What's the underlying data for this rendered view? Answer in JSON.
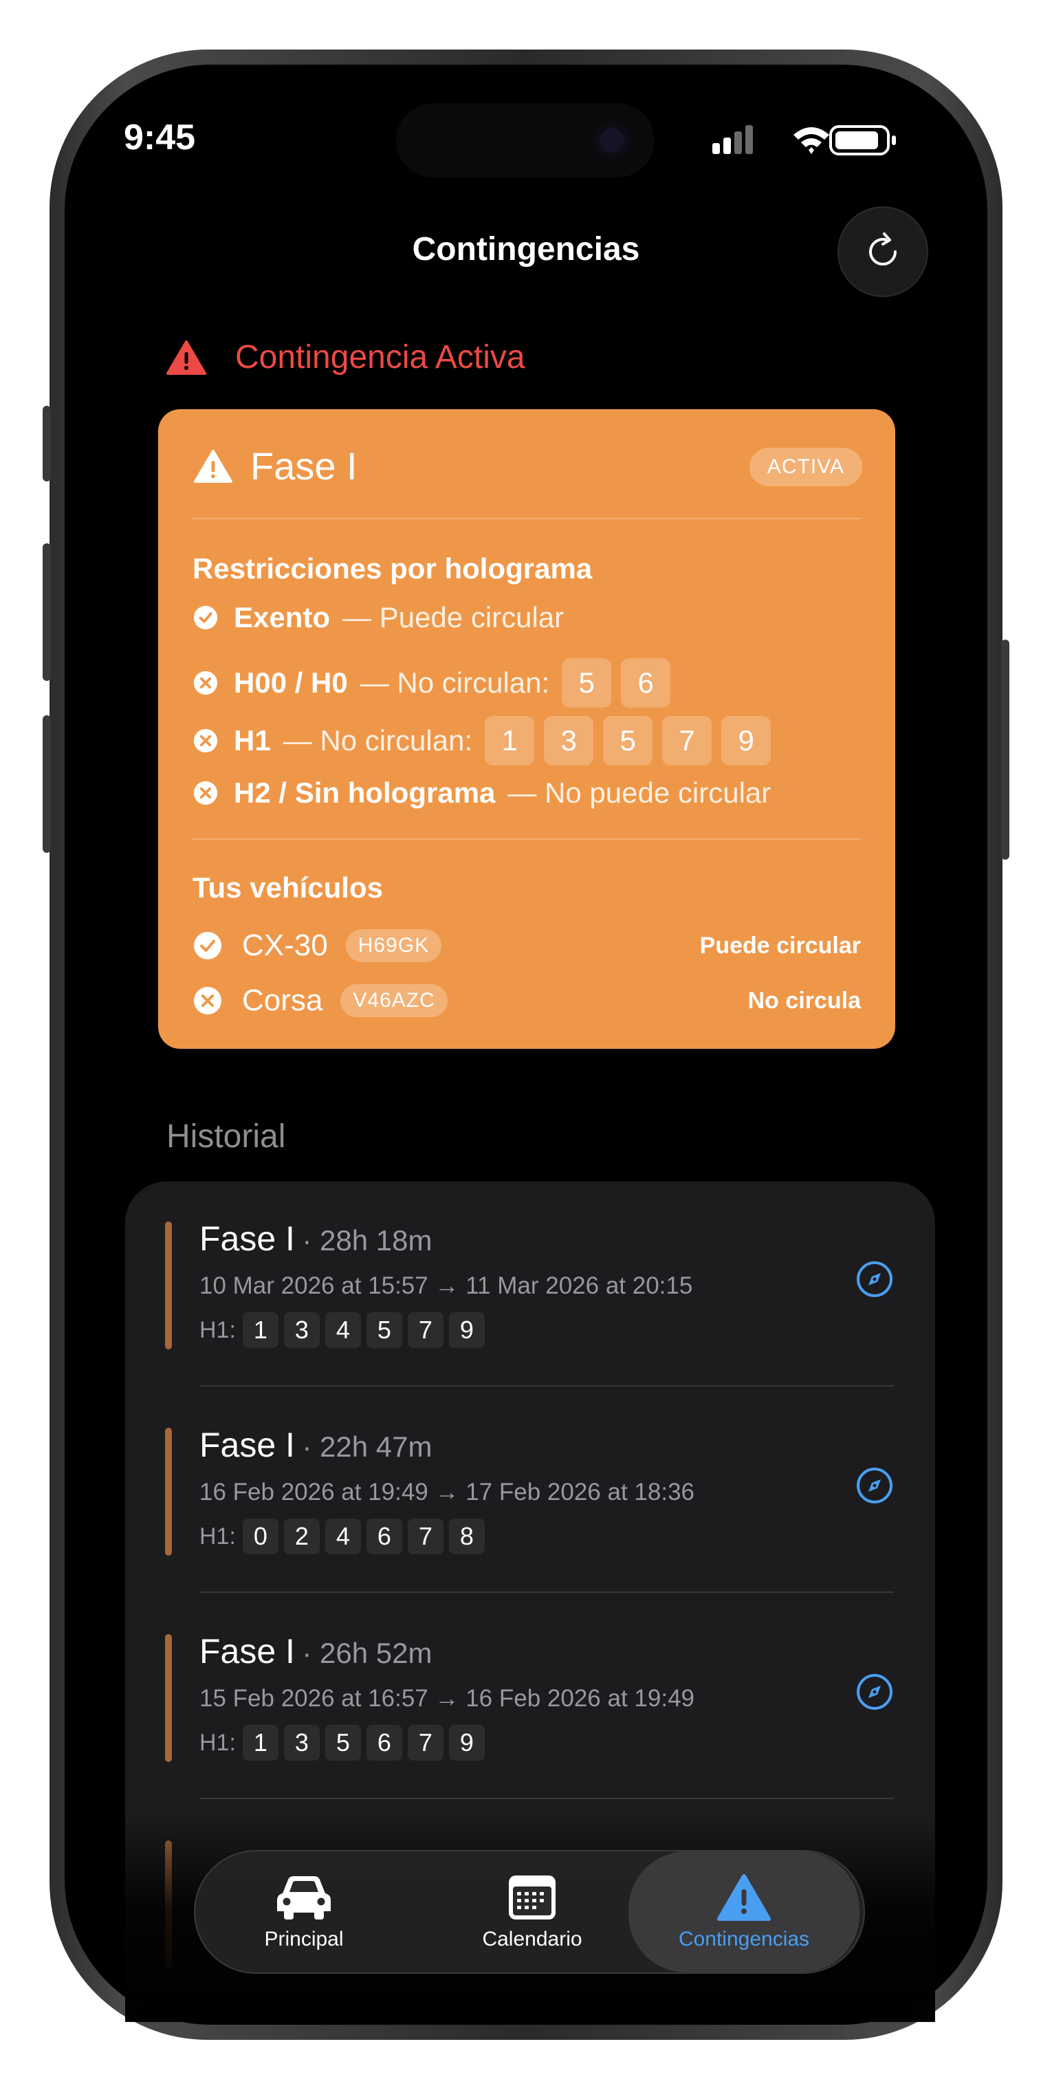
{
  "status_bar": {
    "time": "9:45"
  },
  "nav": {
    "title": "Contingencias"
  },
  "alert": {
    "title": "Contingencia Activa"
  },
  "active_card": {
    "title": "Fase I",
    "badge": "ACTIVA",
    "restrictions_label": "Restricciones por holograma",
    "rules": [
      {
        "name": "Exento",
        "desc": "— Puede circular",
        "digits": [],
        "status": "allowed"
      },
      {
        "name": "H00 / H0",
        "desc": "— No circulan:",
        "digits": [
          "5",
          "6"
        ],
        "status": "blocked"
      },
      {
        "name": "H1",
        "desc": "— No circulan:",
        "digits": [
          "1",
          "3",
          "5",
          "7",
          "9"
        ],
        "status": "blocked"
      },
      {
        "name": "H2 / Sin holograma",
        "desc": "— No puede circular",
        "digits": [],
        "status": "blocked"
      }
    ],
    "vehicles_label": "Tus vehículos",
    "vehicles": [
      {
        "name": "CX-30",
        "plate": "H69GK",
        "status_text": "Puede circular",
        "status": "allowed"
      },
      {
        "name": "Corsa",
        "plate": "V46AZC",
        "status_text": "No circula",
        "status": "blocked"
      }
    ]
  },
  "history": {
    "label": "Historial",
    "digits_label": "H1:",
    "items": [
      {
        "phase": "Fase I",
        "duration": "· 28h 18m",
        "dates": "10 Mar 2026 at 15:57 → 11 Mar 2026 at 20:15",
        "digits": [
          "1",
          "3",
          "4",
          "5",
          "7",
          "9"
        ]
      },
      {
        "phase": "Fase I",
        "duration": "· 22h 47m",
        "dates": "16 Feb 2026 at 19:49 → 17 Feb 2026 at 18:36",
        "digits": [
          "0",
          "2",
          "4",
          "6",
          "7",
          "8"
        ]
      },
      {
        "phase": "Fase I",
        "duration": "· 26h 52m",
        "dates": "15 Feb 2026 at 16:57 → 16 Feb 2026 at 19:49",
        "digits": [
          "1",
          "3",
          "5",
          "6",
          "7",
          "9"
        ]
      }
    ]
  },
  "tabbar": {
    "tabs": [
      {
        "label": "Principal",
        "icon": "car-icon"
      },
      {
        "label": "Calendario",
        "icon": "calendar-icon"
      },
      {
        "label": "Contingencias",
        "icon": "warning-icon",
        "selected": true
      }
    ]
  },
  "colors": {
    "accent": "#4a9ef2",
    "card": "#ef9748",
    "alert_red": "#ec4a45",
    "history_bar": "#a8683a"
  }
}
